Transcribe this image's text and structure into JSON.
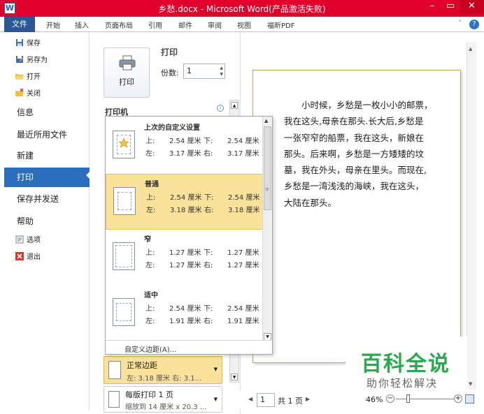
{
  "window": {
    "title": "乡愁.docx - Microsoft Word(产品激活失败)",
    "app_icon_letter": "W",
    "min_glyph": "–",
    "max_glyph": "▭",
    "close_glyph": "✕"
  },
  "ribbon": {
    "tabs": [
      "文件",
      "开始",
      "插入",
      "页面布局",
      "引用",
      "邮件",
      "审阅",
      "视图",
      "福昕PDF"
    ],
    "help_glyph": "?",
    "collapse_glyph": "⌃"
  },
  "backstage": {
    "items": [
      {
        "label": "保存",
        "icon": "save-icon"
      },
      {
        "label": "另存为",
        "icon": "save-as-icon"
      },
      {
        "label": "打开",
        "icon": "open-folder-icon"
      },
      {
        "label": "关闭",
        "icon": "close-folder-icon"
      },
      {
        "label": "信息"
      },
      {
        "label": "最近所用文件"
      },
      {
        "label": "新建"
      },
      {
        "label": "打印",
        "active": true
      },
      {
        "label": "保存并发送"
      },
      {
        "label": "帮助"
      },
      {
        "label": "选项",
        "icon": "options-icon"
      },
      {
        "label": "退出",
        "icon": "exit-icon"
      }
    ]
  },
  "print": {
    "button_label": "打印",
    "heading": "打印",
    "copies_label": "份数:",
    "copies_value": "1",
    "printer_section": "打印机",
    "info_glyph": "i"
  },
  "margins_dropdown": {
    "options": [
      {
        "name": "上次的自定义设置",
        "top": "2.54 厘米",
        "bottom": "2.54 厘米",
        "left": "3.17 厘米",
        "right": "3.17 厘米",
        "highlighted": false
      },
      {
        "name": "普通",
        "top": "2.54 厘米",
        "bottom": "2.54 厘米",
        "left": "3.18 厘米",
        "right": "3.18 厘米",
        "highlighted": true
      },
      {
        "name": "窄",
        "top": "1.27 厘米",
        "bottom": "1.27 厘米",
        "left": "1.27 厘米",
        "right": "1.27 厘米",
        "highlighted": false
      },
      {
        "name": "适中",
        "top": "2.54 厘米",
        "bottom": "2.54 厘米",
        "left": "1.91 厘米",
        "right": "1.91 厘米",
        "highlighted": false
      }
    ],
    "labels": {
      "top": "上:",
      "bottom": "下:",
      "left": "左:",
      "right": "右:"
    },
    "custom_label": "自定义边距(A)..."
  },
  "selected_margins": {
    "name": "正常边距",
    "detail": "左: 3.18 厘米    右: 3.1..."
  },
  "pages_per_sheet": {
    "name": "每版打印 1 页",
    "detail": "缩放到 14 厘米 x 20.3 ..."
  },
  "document": {
    "text": "　　小时候，乡愁是一枚小小的邮票，\n我在这头,母亲在那头.长大后,乡愁是\n一张窄窄的船票，我在这头，新娘在\n那头。后来啊，乡愁是一方矮矮的坟\n墓，我在外头，母亲在里头。而现在,\n乡愁是一湾浅浅的海峡，我在这头，\n大陆在那头。"
  },
  "status": {
    "current_page": "1",
    "total": "共 1 页",
    "zoom": "46%",
    "prev_glyph": "◀",
    "next_glyph": "▶",
    "zoom_minus": "−",
    "zoom_plus": "+"
  },
  "watermark": {
    "title": "百科全说",
    "subtitle": "助你轻松解决"
  },
  "colors": {
    "titlebar": "#e0002a",
    "file_tab": "#2b5797",
    "backstage_active": "#2a6ebd",
    "highlight": "#fbe29a",
    "watermark_green": "#27ab4a"
  }
}
